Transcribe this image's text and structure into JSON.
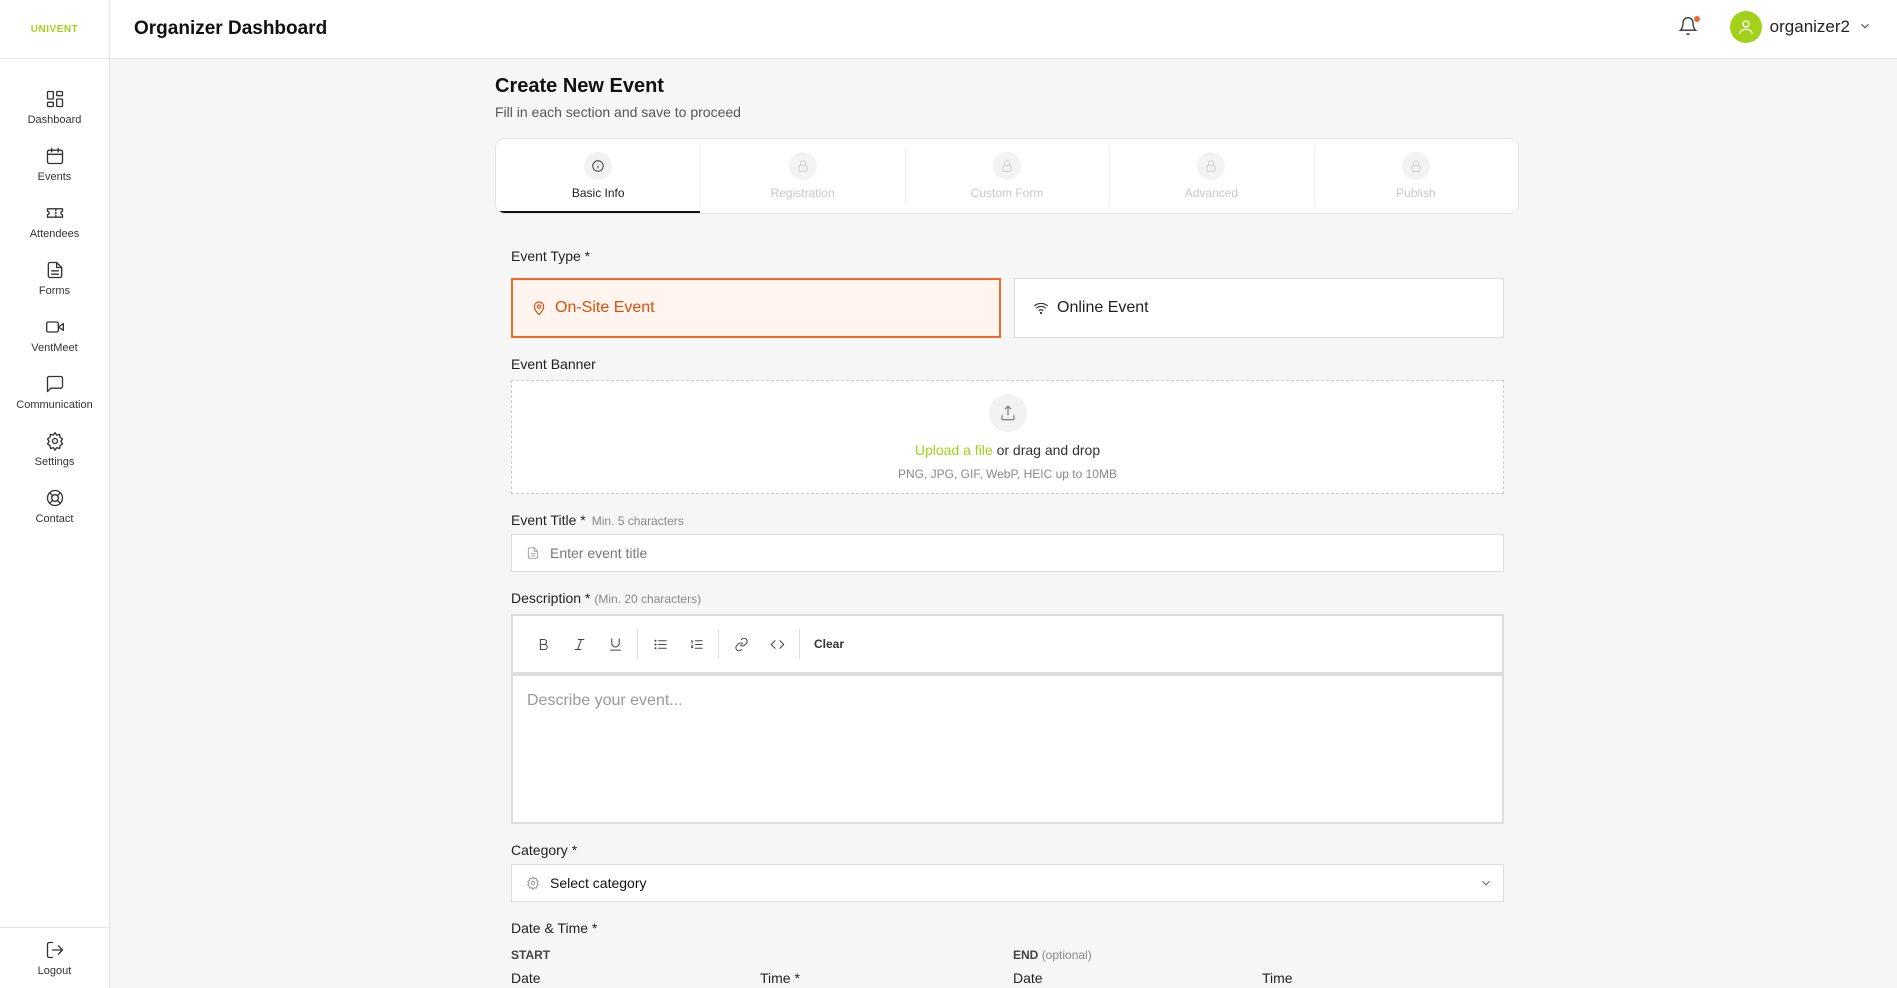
{
  "app": {
    "logo": "UNIVENT"
  },
  "sidebar": {
    "items": [
      {
        "label": "Dashboard",
        "icon": "dashboard-icon"
      },
      {
        "label": "Events",
        "icon": "calendar-icon"
      },
      {
        "label": "Attendees",
        "icon": "ticket-icon"
      },
      {
        "label": "Forms",
        "icon": "document-icon"
      },
      {
        "label": "VentMeet",
        "icon": "video-icon"
      },
      {
        "label": "Communication",
        "icon": "message-icon"
      },
      {
        "label": "Settings",
        "icon": "gear-icon"
      },
      {
        "label": "Contact",
        "icon": "lifebuoy-icon"
      }
    ],
    "logout": "Logout"
  },
  "header": {
    "title": "Organizer Dashboard",
    "username": "organizer2",
    "notification_dot_color": "#f26a2a",
    "accent_color": "#a3d11a"
  },
  "page": {
    "title": "Create New Event",
    "subtitle": "Fill in each section and save to proceed"
  },
  "steps": [
    {
      "label": "Basic Info",
      "state": "active"
    },
    {
      "label": "Registration",
      "state": "locked"
    },
    {
      "label": "Custom Form",
      "state": "locked"
    },
    {
      "label": "Advanced",
      "state": "locked"
    },
    {
      "label": "Publish",
      "state": "locked"
    }
  ],
  "form": {
    "event_type": {
      "label": "Event Type *",
      "options": [
        "On-Site Event",
        "Online Event"
      ],
      "selected": "On-Site Event"
    },
    "banner": {
      "label": "Event Banner",
      "upload_link": "Upload a file",
      "upload_text": "or drag and drop",
      "formats": "PNG, JPG, GIF, WebP, HEIC up to 10MB"
    },
    "title": {
      "label": "Event Title *",
      "hint": "Min. 5 characters",
      "placeholder": "Enter event title",
      "value": ""
    },
    "description": {
      "label": "Description *",
      "hint": "(Min. 20 characters)",
      "placeholder": "Describe your event...",
      "clear_label": "Clear",
      "value": ""
    },
    "category": {
      "label": "Category *",
      "value": "Select category"
    },
    "datetime": {
      "label": "Date & Time *",
      "start_label": "START",
      "end_label": "END",
      "end_optional": "(optional)",
      "start_date_label": "Date",
      "start_time_label": "Time *",
      "end_date_label": "Date",
      "end_time_label": "Time"
    }
  }
}
